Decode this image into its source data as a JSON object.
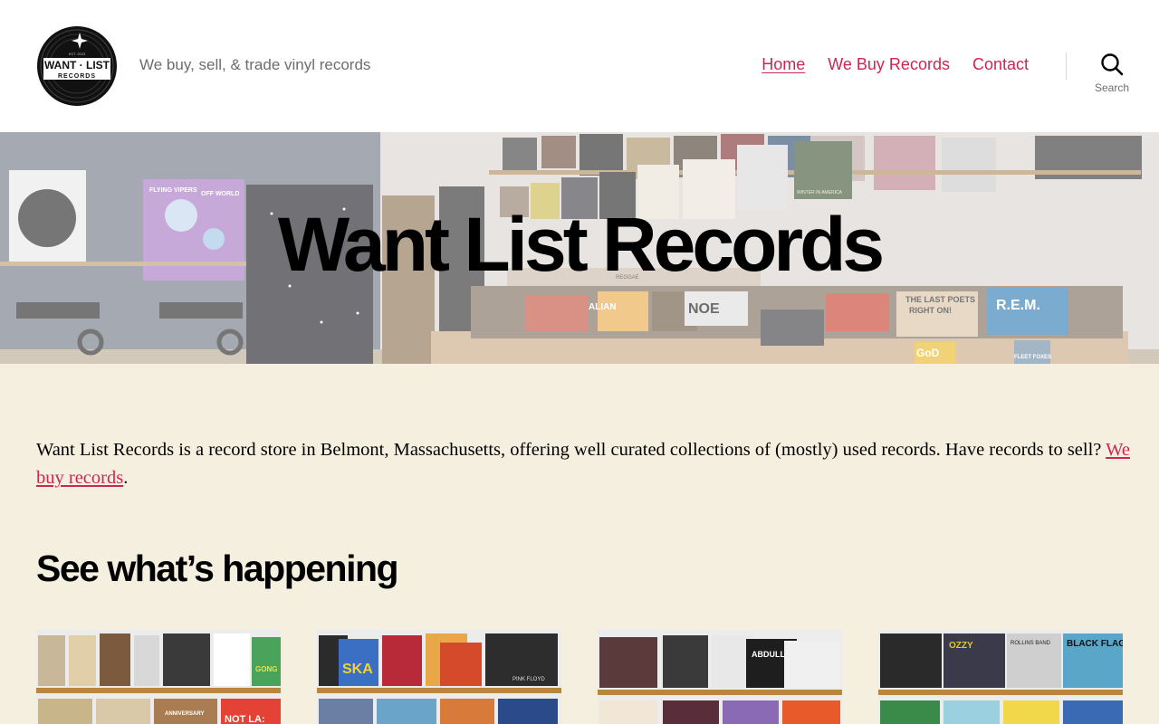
{
  "site": {
    "tagline": "We buy, sell, & trade vinyl records",
    "logo": {
      "line1": "WANT · LIST",
      "line2": "RECORDS",
      "est": "EST. 2023",
      "icon": "sparkle-icon"
    }
  },
  "nav": {
    "items": [
      {
        "label": "Home",
        "current": true
      },
      {
        "label": "We Buy Records",
        "current": false
      },
      {
        "label": "Contact",
        "current": false
      }
    ],
    "search_label": "Search",
    "search_icon": "search-icon"
  },
  "hero": {
    "title": "Want List Records",
    "wall_album_texts": [
      "FLYING VIPERS",
      "OFF WORLD",
      "WINTER IN AMERICA"
    ],
    "bin_album_texts": [
      "ALIAN",
      "NOE",
      "THE LAST POETS",
      "RIGHT ON!",
      "R.E.M.",
      "GoD",
      "FLEET FOXES",
      "REGGAE"
    ]
  },
  "main": {
    "intro_text": "Want List Records is a record store in Belmont, Massachusetts, offering well curated collections of (mostly) used records. Have records to sell? ",
    "intro_link": "We buy records",
    "intro_end": ".",
    "section_title": "See what’s happening",
    "gallery": [
      {
        "album_texts": [
          "GONG",
          "NOT LA:",
          "ANNIVERSARY"
        ]
      },
      {
        "album_texts": [
          "SKA",
          "PINK FLOYD"
        ]
      },
      {
        "album_texts": [
          "ABDULLAH"
        ]
      },
      {
        "album_texts": [
          "OZZY",
          "BLACK FLAG",
          "ROLLINS BAND"
        ]
      }
    ]
  },
  "colors": {
    "accent": "#cd2653",
    "page_background": "#f5efe0",
    "header_background": "#ffffff",
    "muted_text": "#6d6d6d"
  }
}
